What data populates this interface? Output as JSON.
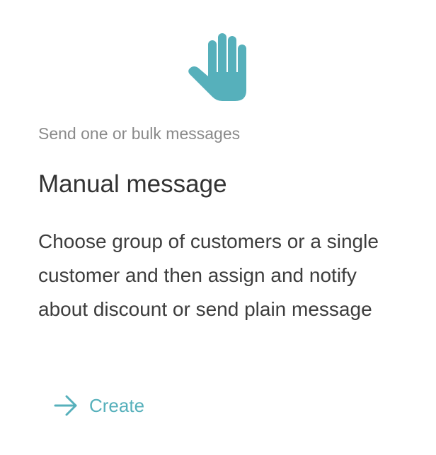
{
  "card": {
    "eyebrow": "Send one or bulk messages",
    "title": "Manual message",
    "description": "Choose group of customers or a single customer and then assign and notify about discount or send plain message",
    "icon": "raised-hand-icon",
    "action": {
      "label": "Create",
      "icon": "arrow-right-icon"
    }
  },
  "colors": {
    "accent": "#56b0bb",
    "eyebrow_text": "#8a8a8a",
    "title_text": "#333333",
    "body_text": "#3d3d3d",
    "background": "#ffffff"
  }
}
